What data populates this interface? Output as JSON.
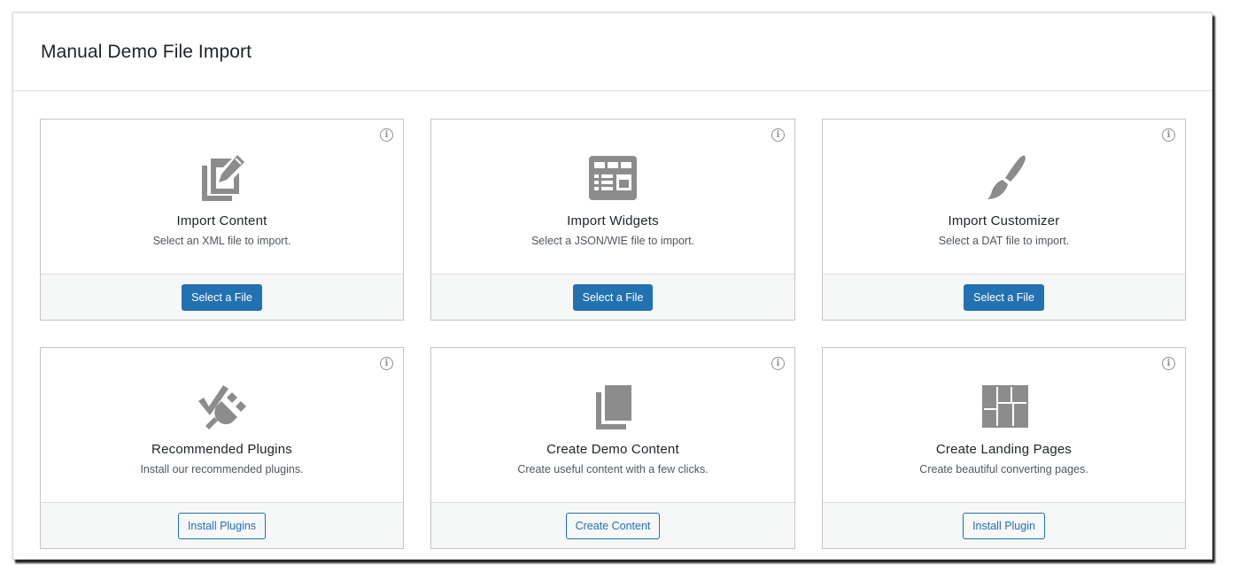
{
  "page": {
    "title": "Manual Demo File Import",
    "info_glyph": "i"
  },
  "cards": [
    {
      "icon": "import-content-icon",
      "title": "Import Content",
      "description": "Select an XML file to import.",
      "button": "Select a File",
      "button_style": "primary"
    },
    {
      "icon": "widgets-icon",
      "title": "Import Widgets",
      "description": "Select a JSON/WIE file to import.",
      "button": "Select a File",
      "button_style": "primary"
    },
    {
      "icon": "paintbrush-icon",
      "title": "Import Customizer",
      "description": "Select a DAT file to import.",
      "button": "Select a File",
      "button_style": "primary"
    },
    {
      "icon": "plugin-icon",
      "title": "Recommended Plugins",
      "description": "Install our recommended plugins.",
      "button": "Install Plugins",
      "button_style": "secondary"
    },
    {
      "icon": "pages-icon",
      "title": "Create Demo Content",
      "description": "Create useful content with a few clicks.",
      "button": "Create Content",
      "button_style": "secondary"
    },
    {
      "icon": "layout-icon",
      "title": "Create Landing Pages",
      "description": "Create beautiful converting pages.",
      "button": "Install Plugin",
      "button_style": "secondary"
    }
  ],
  "colors": {
    "accent": "#2271b1",
    "icon_gray": "#8c8f94",
    "icon_fill": "#8c8c8c"
  }
}
